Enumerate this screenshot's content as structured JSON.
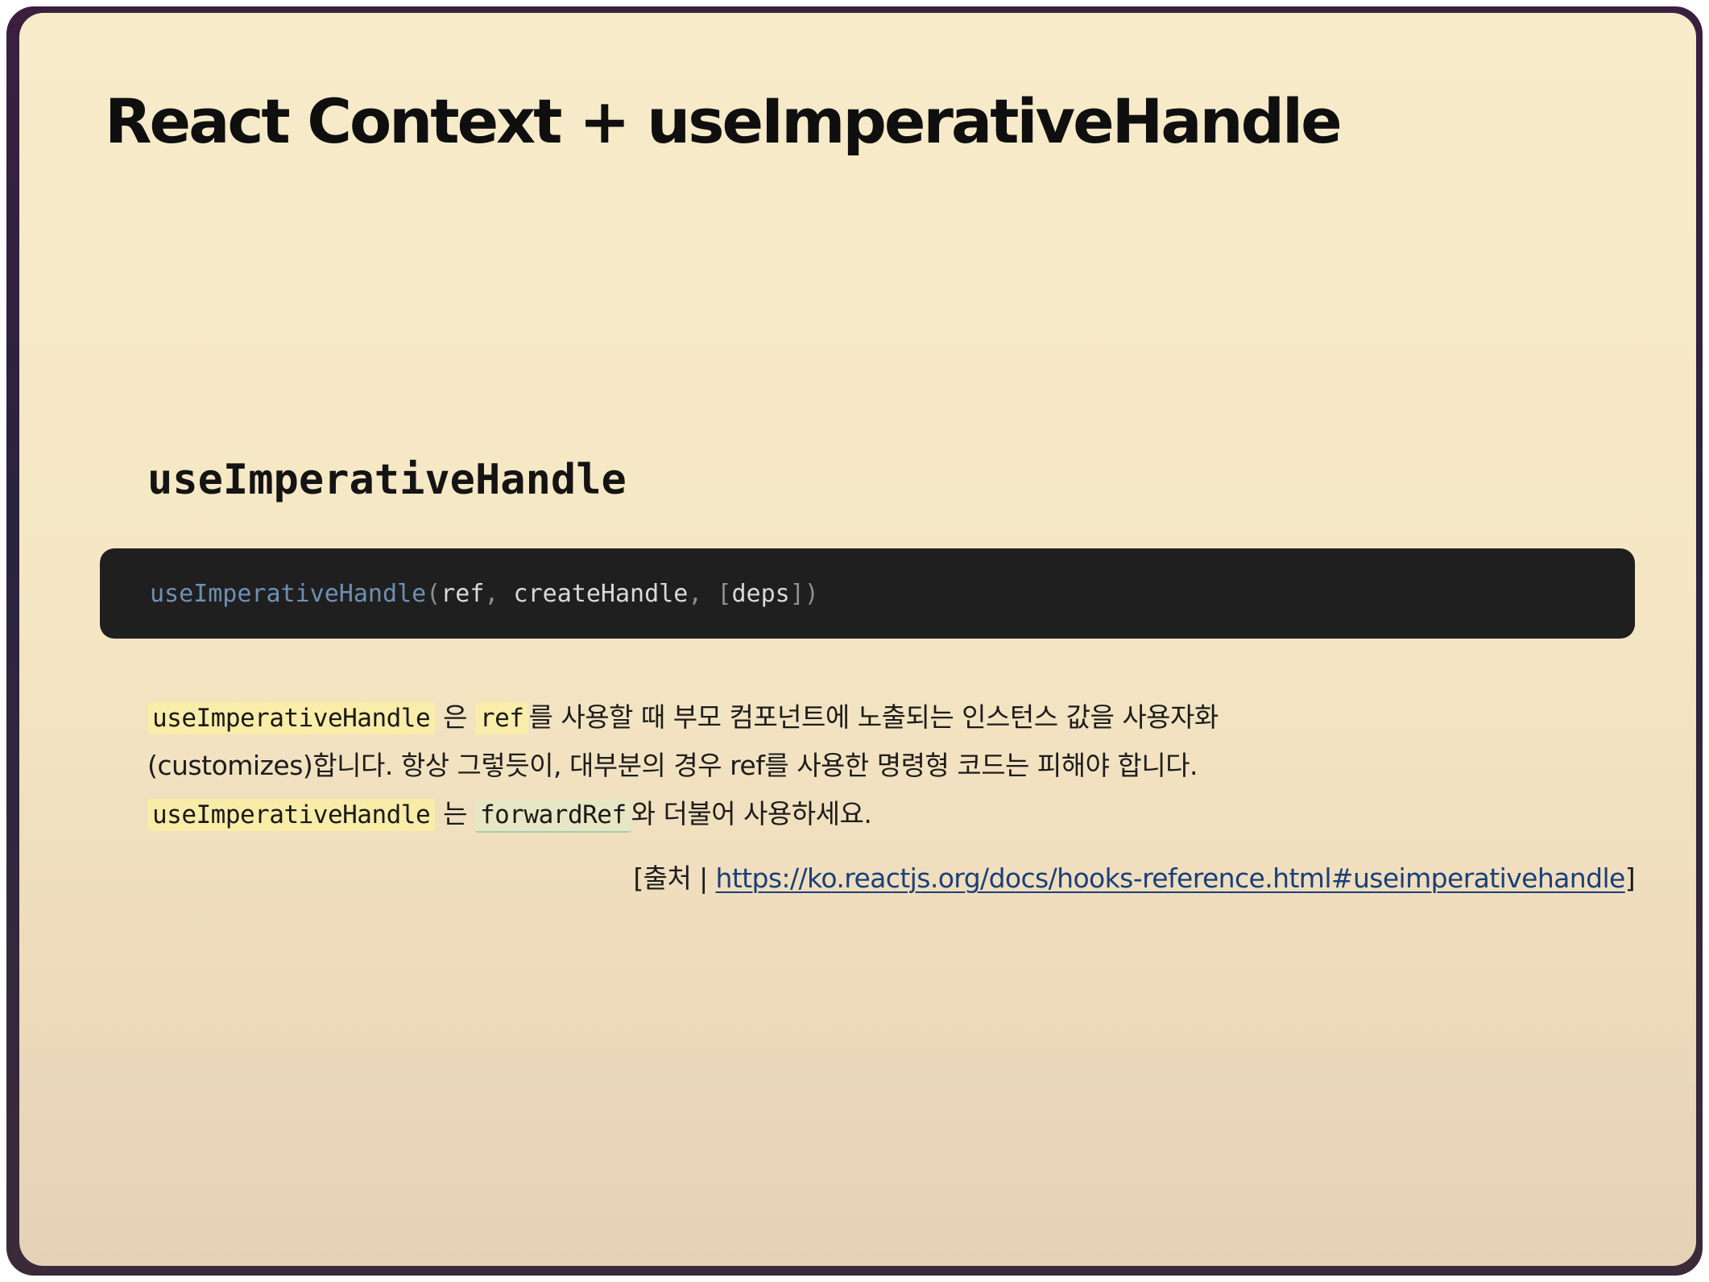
{
  "slide": {
    "title": "React Context + useImperativeHandle",
    "section_title": "useImperativeHandle"
  },
  "code_block": {
    "fn": "useImperativeHandle",
    "open": "(",
    "arg1": "ref",
    "comma1": ", ",
    "arg2": "createHandle",
    "comma2": ", ",
    "bracket_open": "[",
    "arg3": "deps",
    "close": "])"
  },
  "description": {
    "line1": {
      "code1": "useImperativeHandle",
      "text1": "은",
      "code2": "ref",
      "text2": "를 사용할 때 부모 컴포넌트에 노출되는 인스턴스 값을 사용자화"
    },
    "line2": {
      "text": "(customizes)합니다. 항상 그렇듯이, 대부분의 경우 ref를 사용한 명령형 코드는 피해야 합니다."
    },
    "line3": {
      "code1": "useImperativeHandle",
      "text1": "는",
      "code2": "forwardRef",
      "text2": "와 더불어 사용하세요."
    }
  },
  "source": {
    "prefix": "[출처 | ",
    "link": "https://ko.reactjs.org/docs/hooks-reference.html#useimperativehandle",
    "suffix": "]"
  }
}
